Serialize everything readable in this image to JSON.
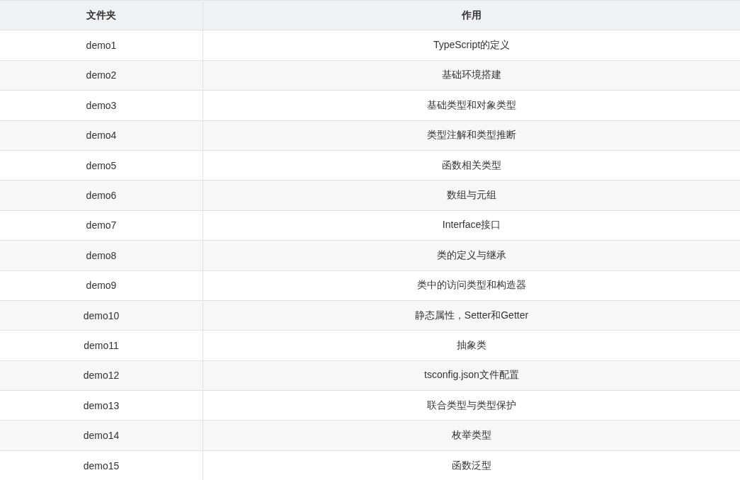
{
  "table": {
    "columns": [
      "文件夹",
      "作用"
    ],
    "rows": [
      [
        "demo1",
        "TypeScript的定义"
      ],
      [
        "demo2",
        "基础环境搭建"
      ],
      [
        "demo3",
        "基础类型和对象类型"
      ],
      [
        "demo4",
        "类型注解和类型推断"
      ],
      [
        "demo5",
        "函数相关类型"
      ],
      [
        "demo6",
        "数组与元组"
      ],
      [
        "demo7",
        "Interface接口"
      ],
      [
        "demo8",
        "类的定义与继承"
      ],
      [
        "demo9",
        "类中的访问类型和构造器"
      ],
      [
        "demo10",
        "静态属性，Setter和Getter"
      ],
      [
        "demo11",
        "抽象类"
      ],
      [
        "demo12",
        "tsconfig.json文件配置"
      ],
      [
        "demo13",
        "联合类型与类型保护"
      ],
      [
        "demo14",
        "枚举类型"
      ],
      [
        "demo15",
        "函数泛型"
      ]
    ]
  }
}
